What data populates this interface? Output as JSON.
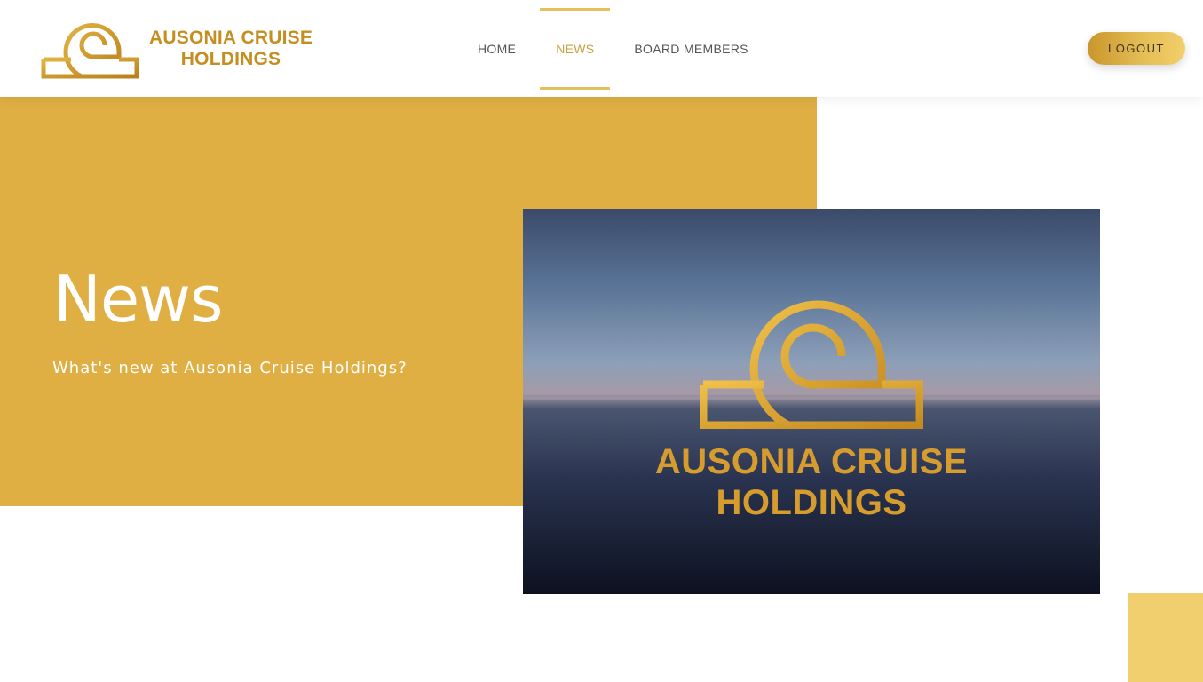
{
  "header": {
    "logo": {
      "icon": "ausonia-spiral-logo-icon",
      "line1": "AUSONIA CRUISE",
      "line2": "HOLDINGS"
    },
    "nav": [
      {
        "label": "HOME",
        "active": false
      },
      {
        "label": "NEWS",
        "active": true
      },
      {
        "label": "BOARD MEMBERS",
        "active": false
      }
    ],
    "logout_label": "LOGOUT"
  },
  "hero": {
    "title": "News",
    "subtitle": "What's new at Ausonia Cruise Holdings?"
  },
  "hero_image": {
    "logo_line1": "AUSONIA CRUISE",
    "logo_line2": "HOLDINGS"
  },
  "colors": {
    "brand_gold": "#dfaf44",
    "accent_gold": "#c9a13b",
    "light_gold": "#f2cf6e"
  }
}
